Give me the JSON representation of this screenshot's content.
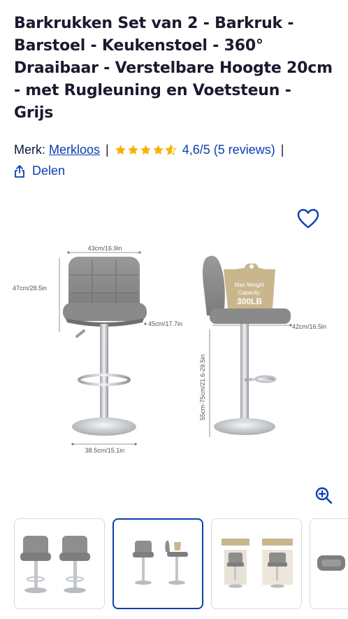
{
  "product": {
    "title": "Barkrukken Set van 2 - Barkruk - Barstoel - Keukenstoel - 360° Draaibaar - Verstelbare Hoogte 20cm - met Rugleuning en Voetsteun - Grijs"
  },
  "meta": {
    "brand_label": "Merk:",
    "brand_name": "Merkloos",
    "separator": "|",
    "rating_value": 4.6,
    "rating_text": "4,6/5 (5 reviews)",
    "trailing_separator": "|"
  },
  "share": {
    "label": "Delen"
  },
  "image": {
    "dims": {
      "top_width": "43cm/16.9in",
      "back_height": "47cm/28.5in",
      "seat_depth": "45cm/17.7in",
      "base_width": "38.5cm/15.1in",
      "side_depth": "42cm/16.5in",
      "height_range": "55cm-75cm/21.6-29.5in"
    },
    "capacity_label": "Max Weight Capacity:",
    "capacity_value": "300LB"
  },
  "icons": {
    "favorite": "heart-icon",
    "zoom": "zoom-in-icon",
    "share": "share-icon",
    "star": "star-icon"
  },
  "colors": {
    "link": "#0a3fae",
    "star": "#f5b301",
    "seat": "#8d8d8d",
    "chrome": "#c8cbcf"
  },
  "thumbnails": {
    "count_visible": 4,
    "active_index": 1
  }
}
